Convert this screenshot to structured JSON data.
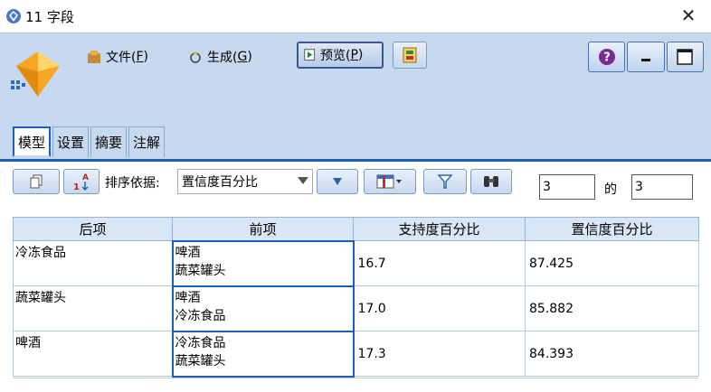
{
  "window": {
    "title": "11 字段",
    "close_glyph": "✕"
  },
  "menu": {
    "file_label": "文件(",
    "file_key": "F",
    "file_close": ")",
    "generate_label": "生成(",
    "generate_key": "G",
    "generate_close": ")",
    "preview_label": "预览(",
    "preview_key": "P",
    "preview_close": ")"
  },
  "tabs": [
    {
      "label": "模型",
      "active": true
    },
    {
      "label": "设置",
      "active": false
    },
    {
      "label": "摘要",
      "active": false
    },
    {
      "label": "注解",
      "active": false
    }
  ],
  "toolbar": {
    "sort_label": "排序依据:",
    "sort_value": "置信度百分比",
    "page_current": "3",
    "page_of_label": "的",
    "page_total": "3"
  },
  "table": {
    "headers": [
      "后项",
      "前项",
      "支持度百分比",
      "置信度百分比"
    ],
    "rows": [
      {
        "consequent": "冷冻食品",
        "antecedents": [
          "啤酒",
          "蔬菜罐头"
        ],
        "support": "16.7",
        "confidence": "87.425"
      },
      {
        "consequent": "蔬菜罐头",
        "antecedents": [
          "啤酒",
          "冷冻食品"
        ],
        "support": "17.0",
        "confidence": "85.882"
      },
      {
        "consequent": "啤酒",
        "antecedents": [
          "冷冻食品",
          "蔬菜罐头"
        ],
        "support": "17.3",
        "confidence": "84.393"
      }
    ]
  },
  "colors": {
    "chrome_bg": "#c7d9ee",
    "accent": "#1b5fb6",
    "header_bg": "#d8e6f5"
  }
}
